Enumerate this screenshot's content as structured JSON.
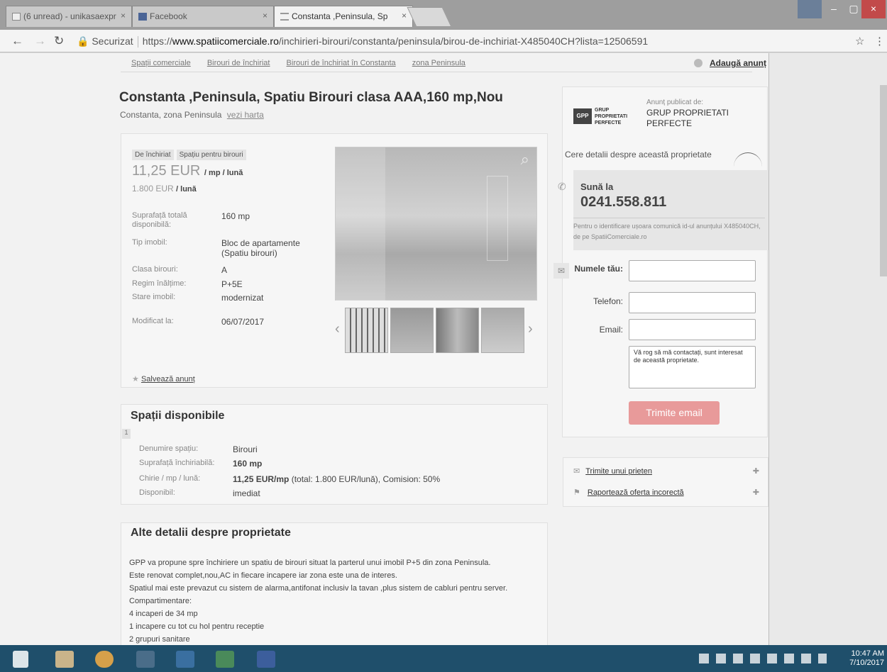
{
  "browser": {
    "tabs": [
      {
        "label": "(6 unread) - unikasaexpr",
        "active": false
      },
      {
        "label": "Facebook",
        "active": false
      },
      {
        "label": "Constanta ,Peninsula, Sp",
        "active": true
      }
    ],
    "close_glyph": "×",
    "secure_label": "Securizat",
    "url_scheme": "https://",
    "url_host": "www.spatiicomerciale.ro",
    "url_path": "/inchirieri-birouri/constanta/peninsula/birou-de-inchiriat-X485040CH?lista=12506591"
  },
  "breadcrumbs": [
    "Spații comerciale",
    "Birouri de închiriat",
    "Birouri de închiriat în Constanta",
    "zona Peninsula"
  ],
  "add_ad_label": "Adaugă anunț",
  "listing": {
    "title": "Constanta ,Peninsula, Spatiu Birouri clasa AAA,160 mp,Nou",
    "location": "Constanta, zona Peninsula",
    "map_link": "vezi harta",
    "tags": [
      "De închiriat",
      "Spațiu pentru birouri"
    ],
    "price_main": "11,25 EUR",
    "price_main_unit": "/ mp / lună",
    "price_total": "1.800 EUR",
    "price_total_unit": "/ lună",
    "details": [
      {
        "label": "Suprafață totală disponibilă:",
        "value": "160 mp"
      },
      {
        "label": "Tip imobil:",
        "value": "Bloc de apartamente (Spatiu birouri)"
      },
      {
        "label": "Clasa birouri:",
        "value": "A"
      },
      {
        "label": "Regim înălțime:",
        "value": "P+5E"
      },
      {
        "label": "Stare imobil:",
        "value": "modernizat"
      },
      {
        "label": "Modificat la:",
        "value": "06/07/2017"
      }
    ],
    "save_label": "Salvează anunț"
  },
  "spaces": {
    "title": "Spații disponibile",
    "index": "1",
    "rows": [
      {
        "label": "Denumire spațiu:",
        "value": "Birouri",
        "bold": ""
      },
      {
        "label": "Suprafață închiriabilă:",
        "value": "160 mp",
        "bold": "1"
      },
      {
        "label": "Chirie / mp / lună:",
        "value": "11,25 EUR/mp",
        "extra": " (total: 1.800 EUR/lună), Comision: 50%"
      },
      {
        "label": "Disponibil:",
        "value": "imediat",
        "bold": ""
      }
    ]
  },
  "details_section": {
    "title": "Alte detalii despre proprietate",
    "lines": [
      "GPP va propune spre închiriere un spatiu de birouri situat la parterul unui imobil P+5 din zona Peninsula.",
      "Este renovat complet,nou,AC in fiecare incapere iar zona este una de interes.",
      "Spatiul mai este prevazut cu sistem de alarma,antifonat inclusiv la tavan ,plus sistem de cabluri pentru server.",
      "Compartimentare:",
      "4 incaperi de 34 mp",
      "1 incapere cu tot cu hol pentru receptie",
      "2 grupuri sanitare"
    ]
  },
  "agent": {
    "published_by": "Anunț publicat de:",
    "name": "GRUP PROPRIETATI PERFECTE",
    "logo_text": "GRUP PROPRIETATI PERFECTE",
    "logo_mark": "GPP",
    "request_details": "Cere detalii despre această proprietate",
    "call_label": "Sună la",
    "phone": "0241.558.811",
    "call_note": "Pentru o identificare ușoara comunică id-ul anunțului X485040CH, de pe SpatiiComerciale.ro"
  },
  "form": {
    "name_label": "Numele tău:",
    "phone_label": "Telefon:",
    "email_label": "Email:",
    "message": "Vă rog să mă contactați, sunt interesat de această proprietate.",
    "send_label": "Trimite email"
  },
  "side_links": [
    "Trimite unui prieten",
    "Raportează oferta incorectă"
  ],
  "taskbar": {
    "time": "10:47 AM",
    "date": "7/10/2017"
  },
  "colors": {
    "accent": "#e89a9a",
    "link": "#333333",
    "taskbar": "#1f4f6b"
  },
  "icons": [
    "search-icon",
    "phone-icon",
    "mail-icon",
    "star-icon",
    "flag-icon",
    "plus-icon",
    "windows-icon"
  ]
}
